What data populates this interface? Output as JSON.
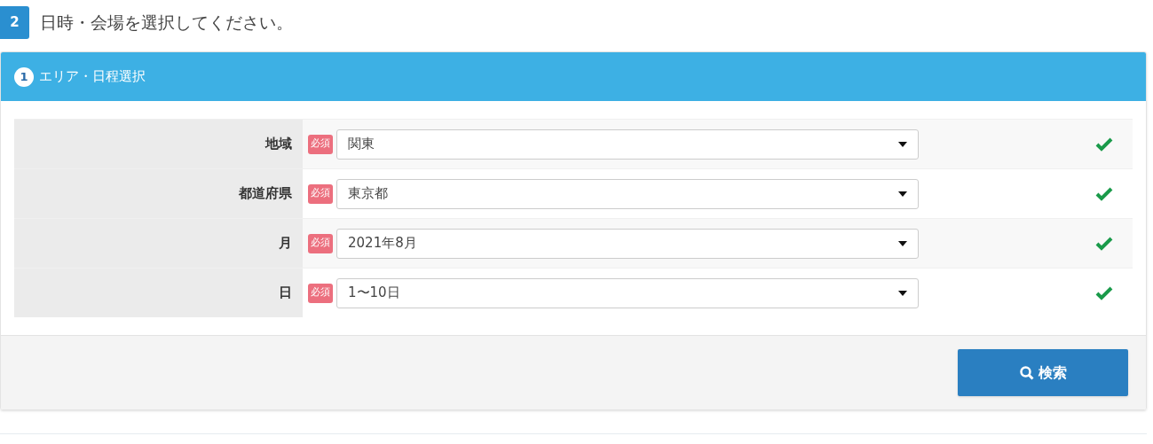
{
  "step": {
    "number": "2",
    "title": "日時・会場を選択してください。"
  },
  "panel": {
    "number": "1",
    "title": "エリア・日程選択"
  },
  "fields": [
    {
      "label": "地域",
      "required": true,
      "required_label": "必須",
      "value": "関東",
      "valid": true
    },
    {
      "label": "都道府県",
      "required": true,
      "required_label": "必須",
      "value": "東京都",
      "valid": true
    },
    {
      "label": "月",
      "required": true,
      "required_label": "必須",
      "value": "2021年8月",
      "valid": true
    },
    {
      "label": "日",
      "required": true,
      "required_label": "必須",
      "value": "1〜10日",
      "valid": true
    }
  ],
  "search_button": {
    "label": "検索"
  }
}
